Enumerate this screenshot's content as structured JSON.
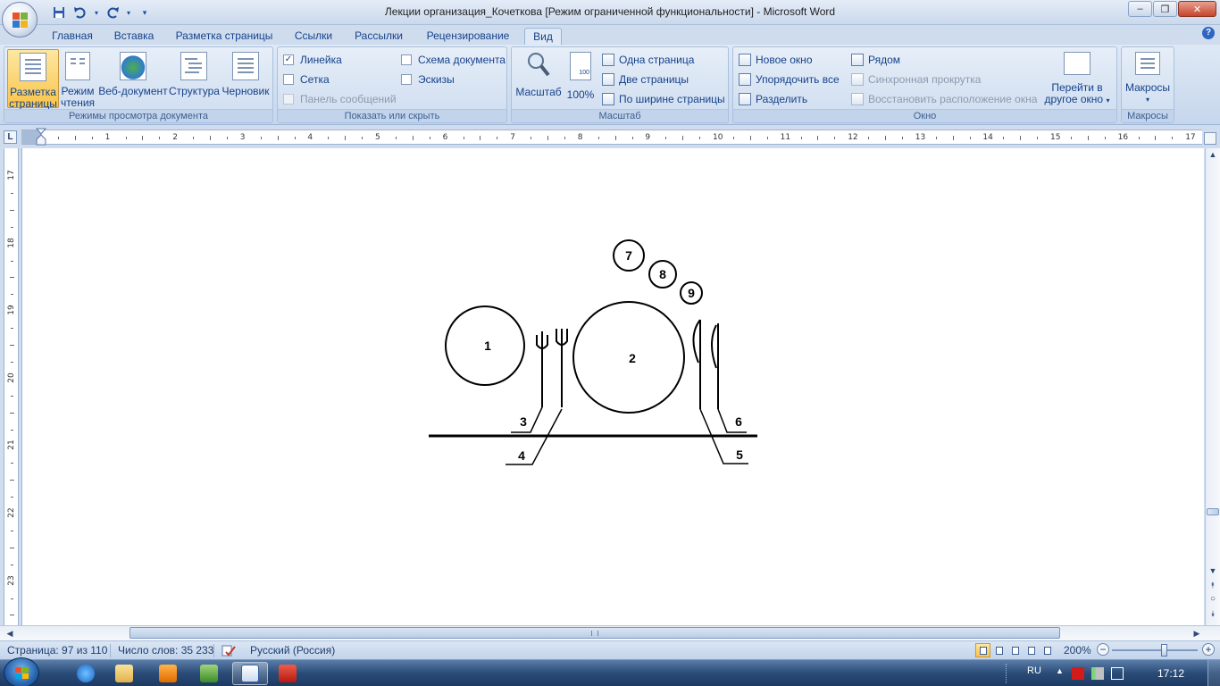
{
  "titlebar": {
    "title": "Лекции организация_Кочеткова [Режим ограниченной функциональности]  -  Microsoft Word",
    "minimize": "‒",
    "maximize": "❐",
    "close": "✕"
  },
  "tabs": [
    "Главная",
    "Вставка",
    "Разметка страницы",
    "Ссылки",
    "Рассылки",
    "Рецензирование",
    "Вид"
  ],
  "help": "?",
  "ribbon": {
    "view_modes": {
      "label": "Режимы просмотра документа",
      "buttons": [
        {
          "l1": "Разметка",
          "l2": "страницы"
        },
        {
          "l1": "Режим",
          "l2": "чтения"
        },
        {
          "l1": "Веб-документ",
          "l2": ""
        },
        {
          "l1": "Структура",
          "l2": ""
        },
        {
          "l1": "Черновик",
          "l2": ""
        }
      ]
    },
    "show_hide": {
      "label": "Показать или скрыть",
      "ruler": "Линейка",
      "grid": "Сетка",
      "message_bar": "Панель сообщений",
      "doc_map": "Схема документа",
      "thumbnails": "Эскизы"
    },
    "zoom": {
      "label": "Масштаб",
      "zoom_btn": "Масштаб",
      "hundred": "100%",
      "hundred_icon": "100",
      "one_page": "Одна страница",
      "two_pages": "Две страницы",
      "page_width": "По ширине страницы"
    },
    "window": {
      "label": "Окно",
      "new_window": "Новое окно",
      "arrange_all": "Упорядочить все",
      "split": "Разделить",
      "side_by_side": "Рядом",
      "sync_scroll": "Синхронная прокрутка",
      "reset_position": "Восстановить расположение окна",
      "switch_l1": "Перейти в",
      "switch_l2": "другое окно"
    },
    "macros": {
      "label": "Макросы",
      "btn": "Макросы"
    }
  },
  "ruler": {
    "corner": "L",
    "h_numbers": [
      "1",
      "2",
      "3",
      "4",
      "5",
      "6",
      "7",
      "8",
      "9",
      "10",
      "11",
      "12",
      "13",
      "14",
      "15",
      "16",
      "17"
    ],
    "v_numbers": [
      "17",
      "18",
      "19",
      "20",
      "21",
      "22",
      "23"
    ]
  },
  "drawing": {
    "labels": [
      "1",
      "2",
      "3",
      "4",
      "5",
      "6",
      "7",
      "8",
      "9"
    ]
  },
  "statusbar": {
    "page": "Страница: 97 из 110",
    "words": "Число слов: 35 233",
    "language": "Русский (Россия)",
    "zoom": "200%",
    "zoom_minus": "−",
    "zoom_plus": "+"
  },
  "taskbar": {
    "tray_lang": "RU",
    "clock": "17:12"
  }
}
